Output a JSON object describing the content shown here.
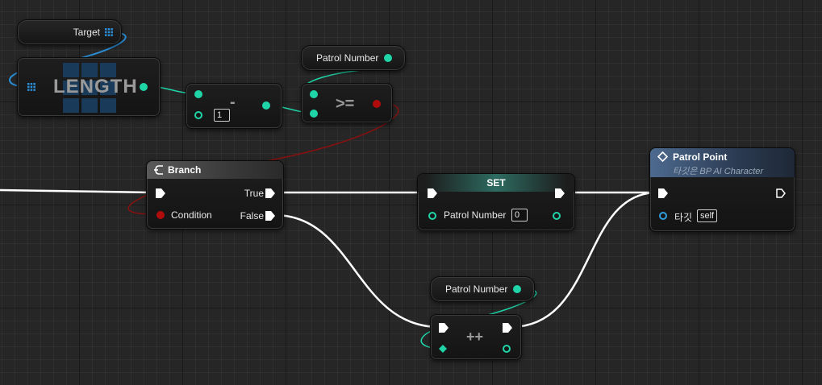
{
  "nodes": {
    "target": {
      "label": "Target"
    },
    "length": {
      "title": "LENGTH"
    },
    "subtract": {
      "op": "-",
      "default_value": "1"
    },
    "patrol_var_top": {
      "label": "Patrol Number"
    },
    "compare": {
      "op": ">="
    },
    "branch": {
      "title": "Branch",
      "true_label": "True",
      "condition_label": "Condition",
      "false_label": "False"
    },
    "set": {
      "title": "SET",
      "pin_label": "Patrol Number",
      "default_value": "0"
    },
    "patrol_point": {
      "title": "Patrol Point",
      "subtitle": "타깃은 BP AI Character",
      "target_label": "타깃",
      "target_value": "self"
    },
    "patrol_var_bottom": {
      "label": "Patrol Number"
    },
    "increment": {
      "op": "++"
    }
  },
  "colors": {
    "exec": "#ffffff",
    "integer": "#1fd5a8",
    "boolean": "#b00c0c",
    "object": "#2f9fe0",
    "array": "#2a8fd8"
  },
  "icons": {
    "array": "array-grid-icon",
    "branch": "branch-icon",
    "function": "function-diamond-icon",
    "exec": "exec-arrow-icon"
  }
}
